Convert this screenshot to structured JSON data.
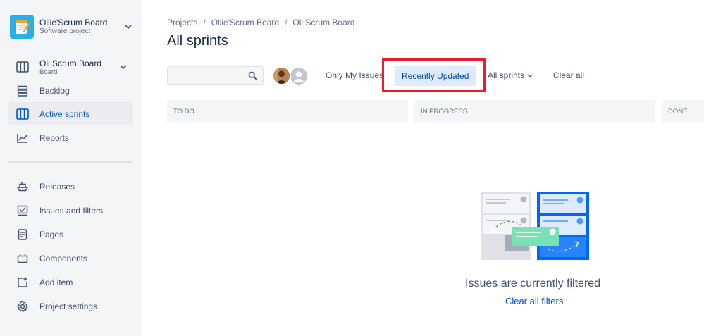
{
  "project": {
    "name": "Ollie'Scrum Board",
    "type": "Software project"
  },
  "sidebar": {
    "board": {
      "name": "Oli Scrum Board",
      "sub": "Board"
    },
    "items": [
      {
        "label": "Backlog",
        "icon": "backlog-icon"
      },
      {
        "label": "Active sprints",
        "icon": "board-columns-icon",
        "active": true
      },
      {
        "label": "Reports",
        "icon": "chart-icon"
      },
      {
        "label": "Releases",
        "icon": "ship-icon"
      },
      {
        "label": "Issues and filters",
        "icon": "filter-issues-icon"
      },
      {
        "label": "Pages",
        "icon": "page-icon"
      },
      {
        "label": "Components",
        "icon": "component-icon"
      },
      {
        "label": "Add item",
        "icon": "add-item-icon"
      },
      {
        "label": "Project settings",
        "icon": "gear-icon"
      }
    ]
  },
  "breadcrumb": [
    "Projects",
    "Ollie'Scrum Board",
    "Oli Scrum Board"
  ],
  "page": {
    "title": "All sprints"
  },
  "search": {
    "value": "",
    "placeholder": ""
  },
  "filters": {
    "only_mine": "Only My Issues",
    "recently_updated": "Recently Updated",
    "all_sprints": "All sprints",
    "clear_all": "Clear all"
  },
  "columns": [
    "TO DO",
    "IN PROGRESS",
    "DONE"
  ],
  "empty_state": {
    "title": "Issues are currently filtered",
    "link": "Clear all filters"
  },
  "colors": {
    "accent": "#0052CC",
    "highlight_box": "#E5202C",
    "selected_filter_bg": "#DEEBFF"
  }
}
